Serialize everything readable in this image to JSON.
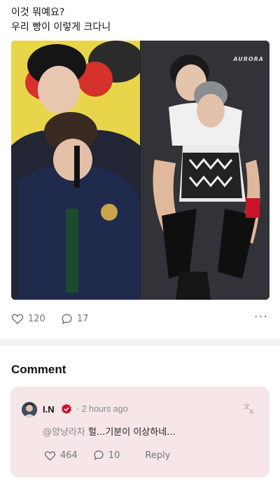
{
  "post": {
    "line1": "이것 뭐예요?",
    "line2": "우리 빵이 이렇게 크다니",
    "photo_label": "AURORA",
    "likes": "120",
    "comments": "17",
    "more_icon": "more-dots-icon"
  },
  "comments_section": {
    "heading": "Comment",
    "items": [
      {
        "author": "I.N",
        "timestamp": "· 2 hours ago",
        "mention": "@양냥라차",
        "text": " 헐...기분이 이상하네...",
        "likes": "464",
        "replies": "10",
        "reply_label": "Reply"
      }
    ]
  },
  "colors": {
    "accent_verified": "#c8102e",
    "card_bg": "#f6e6e7",
    "muted_text": "#777777"
  }
}
